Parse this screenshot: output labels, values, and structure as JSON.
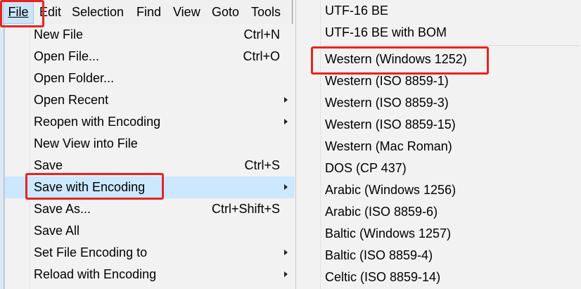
{
  "menubar": {
    "items": [
      {
        "label": "File"
      },
      {
        "label": "Edit"
      },
      {
        "label": "Selection"
      },
      {
        "label": "Find"
      },
      {
        "label": "View"
      },
      {
        "label": "Goto"
      },
      {
        "label": "Tools"
      }
    ]
  },
  "file_menu": {
    "items": [
      {
        "label": "New File",
        "shortcut": "Ctrl+N"
      },
      {
        "label": "Open File...",
        "shortcut": "Ctrl+O"
      },
      {
        "label": "Open Folder...",
        "shortcut": ""
      },
      {
        "label": "Open Recent",
        "shortcut": ""
      },
      {
        "label": "Reopen with Encoding",
        "shortcut": ""
      },
      {
        "label": "New View into File",
        "shortcut": ""
      },
      {
        "label": "Save",
        "shortcut": "Ctrl+S"
      },
      {
        "label": "Save with Encoding",
        "shortcut": ""
      },
      {
        "label": "Save As...",
        "shortcut": "Ctrl+Shift+S"
      },
      {
        "label": "Save All",
        "shortcut": ""
      },
      {
        "label": "Set File Encoding to",
        "shortcut": ""
      },
      {
        "label": "Reload with Encoding",
        "shortcut": ""
      }
    ],
    "highlighted": "Save with Encoding"
  },
  "encoding_submenu": {
    "items": [
      {
        "label": "UTF-16 BE"
      },
      {
        "label": "UTF-16 BE with BOM"
      },
      {
        "label": "Western (Windows 1252)"
      },
      {
        "label": "Western (ISO 8859-1)"
      },
      {
        "label": "Western (ISO 8859-3)"
      },
      {
        "label": "Western (ISO 8859-15)"
      },
      {
        "label": "Western (Mac Roman)"
      },
      {
        "label": "DOS (CP 437)"
      },
      {
        "label": "Arabic (Windows 1256)"
      },
      {
        "label": "Arabic (ISO 8859-6)"
      },
      {
        "label": "Baltic (Windows 1257)"
      },
      {
        "label": "Baltic (ISO 8859-4)"
      },
      {
        "label": "Celtic (ISO 8859-14)"
      }
    ]
  },
  "colors": {
    "highlight": "#cce8ff",
    "annotation": "#e8231f",
    "menu_background": "#f2f2f2"
  }
}
